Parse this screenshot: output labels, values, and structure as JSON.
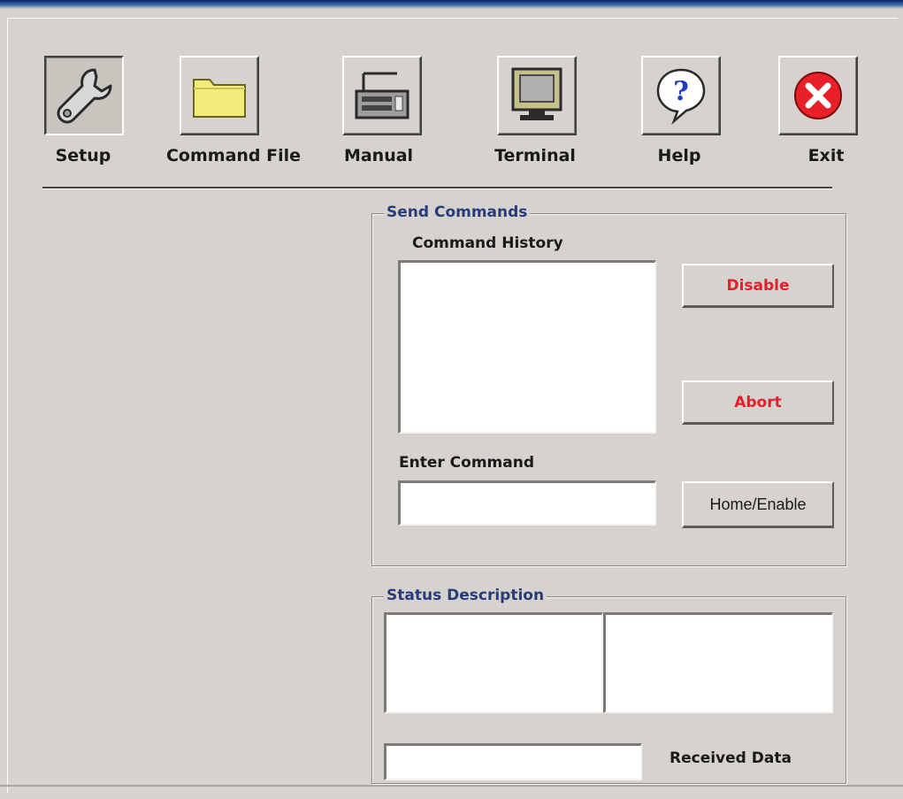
{
  "toolbar": {
    "items": [
      {
        "label": "Setup",
        "icon": "wrench-icon"
      },
      {
        "label": "Command File",
        "icon": "folder-icon"
      },
      {
        "label": "Manual",
        "icon": "keyboard-icon"
      },
      {
        "label": "Terminal",
        "icon": "monitor-icon"
      },
      {
        "label": "Help",
        "icon": "help-question-icon"
      },
      {
        "label": "Exit",
        "icon": "exit-x-icon"
      }
    ]
  },
  "send_commands": {
    "title": "Send Commands",
    "history_label": "Command History",
    "history_value": "",
    "enter_label": "Enter Command",
    "enter_value": "",
    "disable_label": "Disable",
    "abort_label": "Abort",
    "home_enable_label": "Home/Enable"
  },
  "status": {
    "title": "Status Description",
    "left_value": "",
    "right_value": "",
    "received_value": "",
    "received_label": "Received Data"
  },
  "colors": {
    "background": "#d6d3ce",
    "group_title": "#283c7a",
    "alert_text": "#e0202a"
  }
}
